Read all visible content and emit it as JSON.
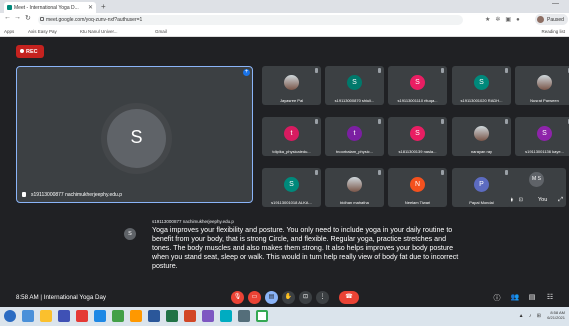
{
  "browser": {
    "tab_title": "Meet - International Yoga D...",
    "url": "meet.google.com/yoq-zunv-nxf?authuser=1",
    "profile_label": "Paused",
    "bookmarks": [
      "Apps",
      "Axis Easy Pay",
      "Ktu Nanul Univer...",
      "Gmail"
    ],
    "reading_list": "Reading list"
  },
  "meet": {
    "rec_label": "REC",
    "main": {
      "initial": "S",
      "name": "s19113000877 nachimukherjeephy.edu.p"
    },
    "tiles": [
      {
        "name": "Jayasree Pal",
        "initial": "",
        "color": "#795548",
        "photo": true
      },
      {
        "name": "s19113000870 shiuli...",
        "initial": "S",
        "color": "#00796b",
        "photo": false
      },
      {
        "name": "s19113001110 rituqa...",
        "initial": "S",
        "color": "#e91e63",
        "photo": false
      },
      {
        "name": "s19113001020 RADH...",
        "initial": "S",
        "color": "#00897b",
        "photo": false
      },
      {
        "name": "Nusrat Parween",
        "initial": "",
        "color": "#9e9e9e",
        "photo": true
      },
      {
        "name": "tdipika_physicaledu...",
        "initial": "t",
        "color": "#d81b60",
        "photo": false
      },
      {
        "name": "tnoorbalam_physic...",
        "initial": "t",
        "color": "#7b1fa2",
        "photo": false
      },
      {
        "name": "s1811300139 nasla...",
        "initial": "S",
        "color": "#e91e63",
        "photo": false
      },
      {
        "name": "narayan ray",
        "initial": "",
        "color": "#6d4c41",
        "photo": true
      },
      {
        "name": "s19113001136 kaye...",
        "initial": "S",
        "color": "#8e24aa",
        "photo": false
      },
      {
        "name": "s19113001018 ALKA...",
        "initial": "S",
        "color": "#00897b",
        "photo": false
      },
      {
        "name": "bidhan mahatha",
        "initial": "",
        "color": "#607d8b",
        "photo": true
      },
      {
        "name": "Neelam Tiwari",
        "initial": "N",
        "color": "#f4511e",
        "photo": false
      },
      {
        "name": "Papai Mondal",
        "initial": "P",
        "color": "#5c6bc0",
        "photo": false
      }
    ],
    "self_tile": {
      "label": "You",
      "initials": "M S"
    },
    "caption": {
      "initial": "S",
      "speaker": "s19113000877 nachimukherjeephy.edu.p",
      "text": "Yoga improves your flexibility and posture. You only need to include yoga in your daily routine to benefit from your body, that is strong Circle, and flexible. Regular yoga, practice stretches and tones. The body muscles and also makes them strong. It also helps improves your body posture when you stand seat, sleep or walk. This would in turn help really view of body fat due to incorrect posture."
    },
    "meeting_info": "8:58 AM | International Yoga Day"
  },
  "taskbar": {
    "time": "8:58 AM",
    "date": "6/21/2021"
  }
}
